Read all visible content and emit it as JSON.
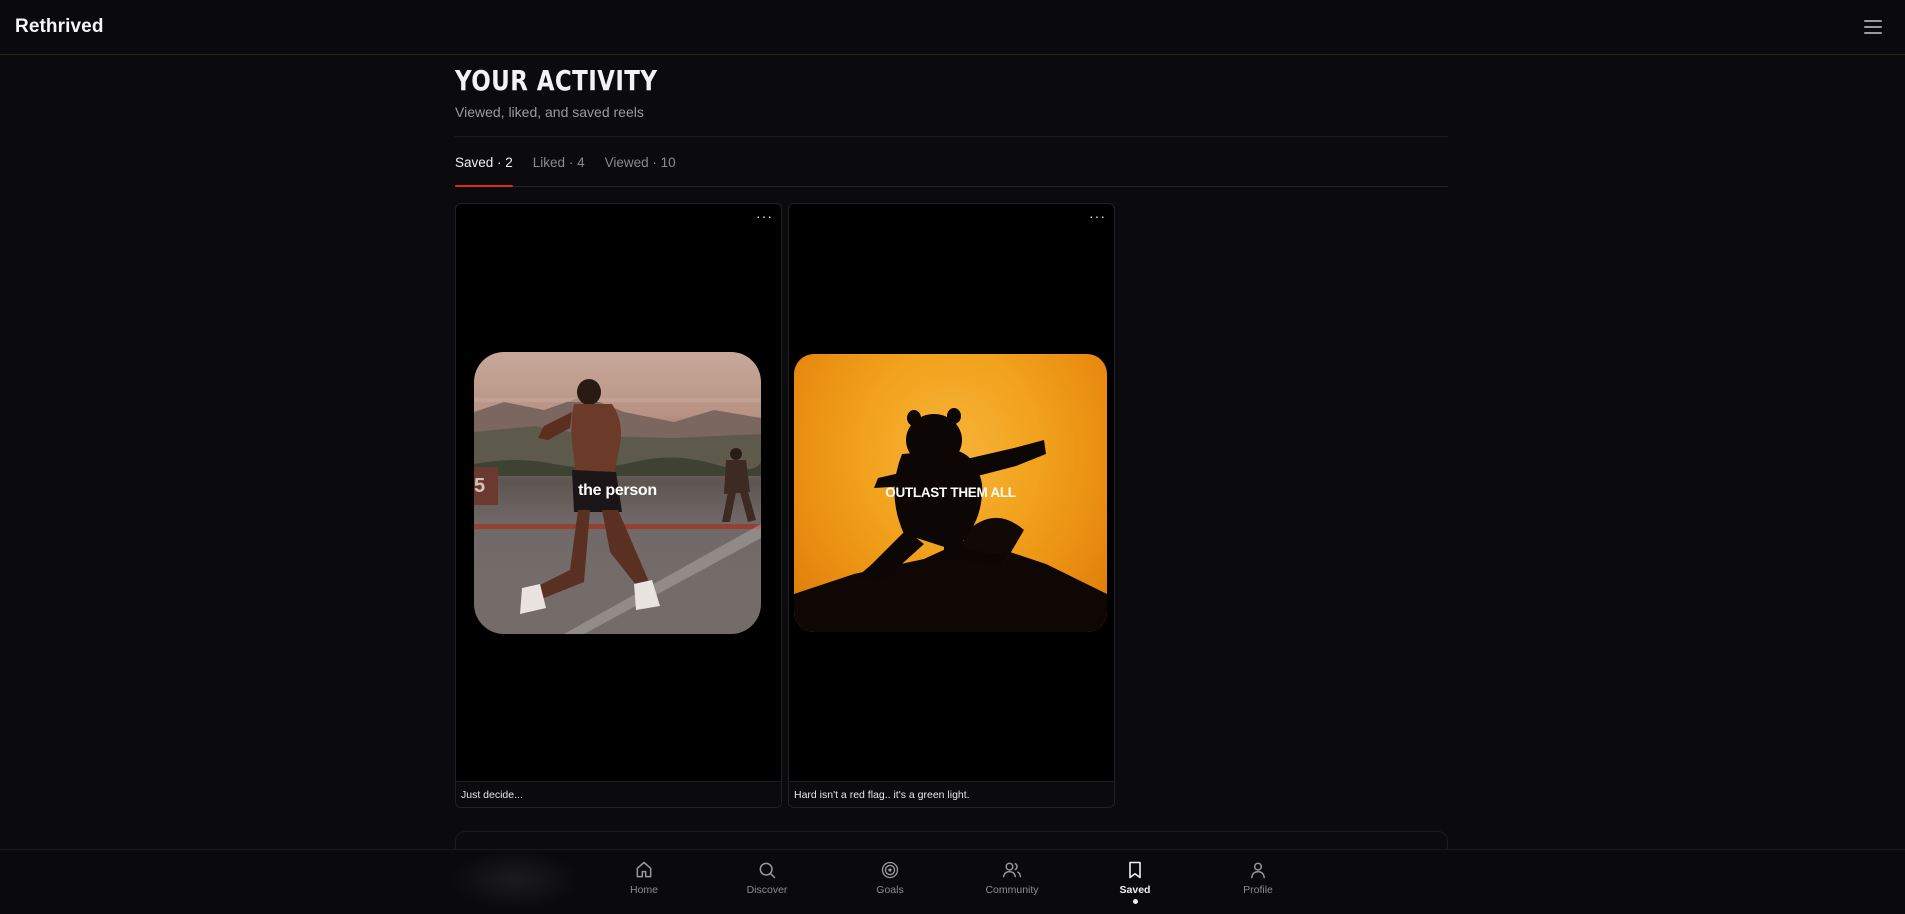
{
  "app": {
    "brand": "Rethrived",
    "menu_icon": "hamburger-icon"
  },
  "page": {
    "title": "YOUR ACTIVITY",
    "subtitle": "Viewed, liked, and saved reels"
  },
  "tabs": [
    {
      "label": "Saved · 2",
      "active": true
    },
    {
      "label": "Liked · 4",
      "active": false
    },
    {
      "label": "Viewed · 10",
      "active": false
    }
  ],
  "reels": [
    {
      "overlay_text": "the person",
      "caption": "Just decide...",
      "menu_label": "···"
    },
    {
      "overlay_text": "OUTLAST THEM ALL",
      "caption": "Hard isn't a red flag.. it's a green light.",
      "menu_label": "···"
    }
  ],
  "bottom_nav": [
    {
      "label": "Home",
      "icon": "home-icon",
      "active": false
    },
    {
      "label": "Discover",
      "icon": "search-icon",
      "active": false
    },
    {
      "label": "Goals",
      "icon": "target-icon",
      "active": false
    },
    {
      "label": "Community",
      "icon": "users-icon",
      "active": false
    },
    {
      "label": "Saved",
      "icon": "bookmark-icon",
      "active": true
    },
    {
      "label": "Profile",
      "icon": "user-icon",
      "active": false
    }
  ],
  "colors": {
    "accent": "#e0262e",
    "background": "#0b0b0d"
  }
}
